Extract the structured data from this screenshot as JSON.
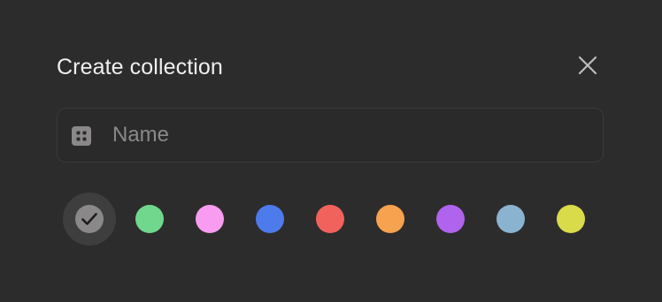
{
  "dialog": {
    "title": "Create collection",
    "close_icon": "close-icon"
  },
  "name_field": {
    "icon": "collection-icon",
    "placeholder": "Name",
    "value": ""
  },
  "colors": {
    "selected_index": 0,
    "options": [
      {
        "name": "gray",
        "hex": "#8a8888"
      },
      {
        "name": "green",
        "hex": "#6fd88c"
      },
      {
        "name": "pink",
        "hex": "#f79cf0"
      },
      {
        "name": "blue",
        "hex": "#4e7bec"
      },
      {
        "name": "red",
        "hex": "#f2625c"
      },
      {
        "name": "orange",
        "hex": "#f7a24f"
      },
      {
        "name": "purple",
        "hex": "#b063ec"
      },
      {
        "name": "light-blue",
        "hex": "#8ab3d0"
      },
      {
        "name": "yellow",
        "hex": "#d9db4b"
      }
    ]
  }
}
